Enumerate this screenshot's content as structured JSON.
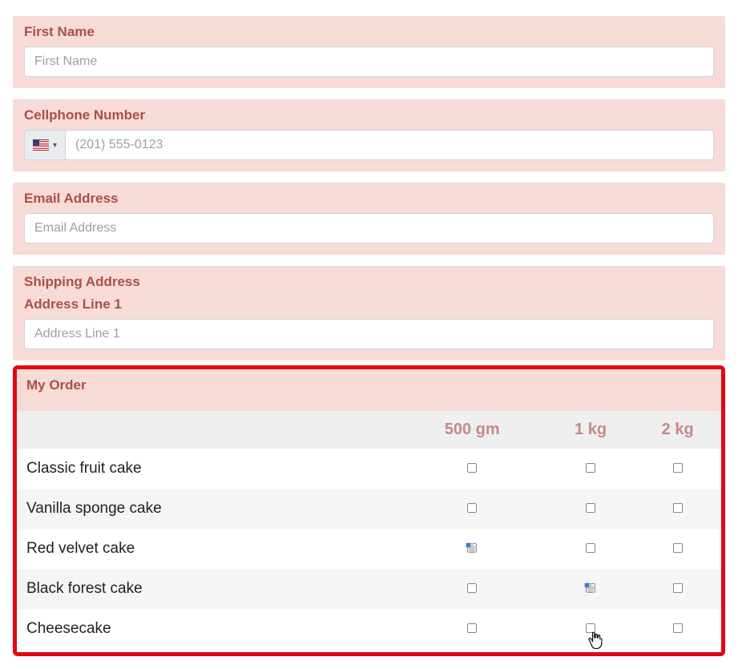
{
  "form": {
    "first_name": {
      "label": "First Name",
      "placeholder": "First Name",
      "value": ""
    },
    "phone": {
      "label": "Cellphone Number",
      "placeholder": "(201) 555-0123",
      "value": "",
      "country": "US"
    },
    "email": {
      "label": "Email Address",
      "placeholder": "Email Address",
      "value": ""
    },
    "shipping": {
      "label": "Shipping Address",
      "line1": {
        "label": "Address Line 1",
        "placeholder": "Address Line 1",
        "value": ""
      }
    }
  },
  "order": {
    "title": "My Order",
    "columns": [
      "",
      "500 gm",
      "1 kg",
      "2 kg"
    ],
    "rows": [
      {
        "name": "Classic fruit cake",
        "cells": [
          false,
          false,
          false
        ],
        "cursor_at": null
      },
      {
        "name": "Vanilla sponge cake",
        "cells": [
          false,
          false,
          false
        ],
        "cursor_at": null
      },
      {
        "name": "Red velvet cake",
        "cells": [
          false,
          false,
          false
        ],
        "cursor_at": 0
      },
      {
        "name": "Black forest cake",
        "cells": [
          false,
          false,
          false
        ],
        "cursor_at": 1
      },
      {
        "name": "Cheesecake",
        "cells": [
          false,
          false,
          false
        ],
        "cursor_at": 1,
        "hand": true
      }
    ]
  }
}
